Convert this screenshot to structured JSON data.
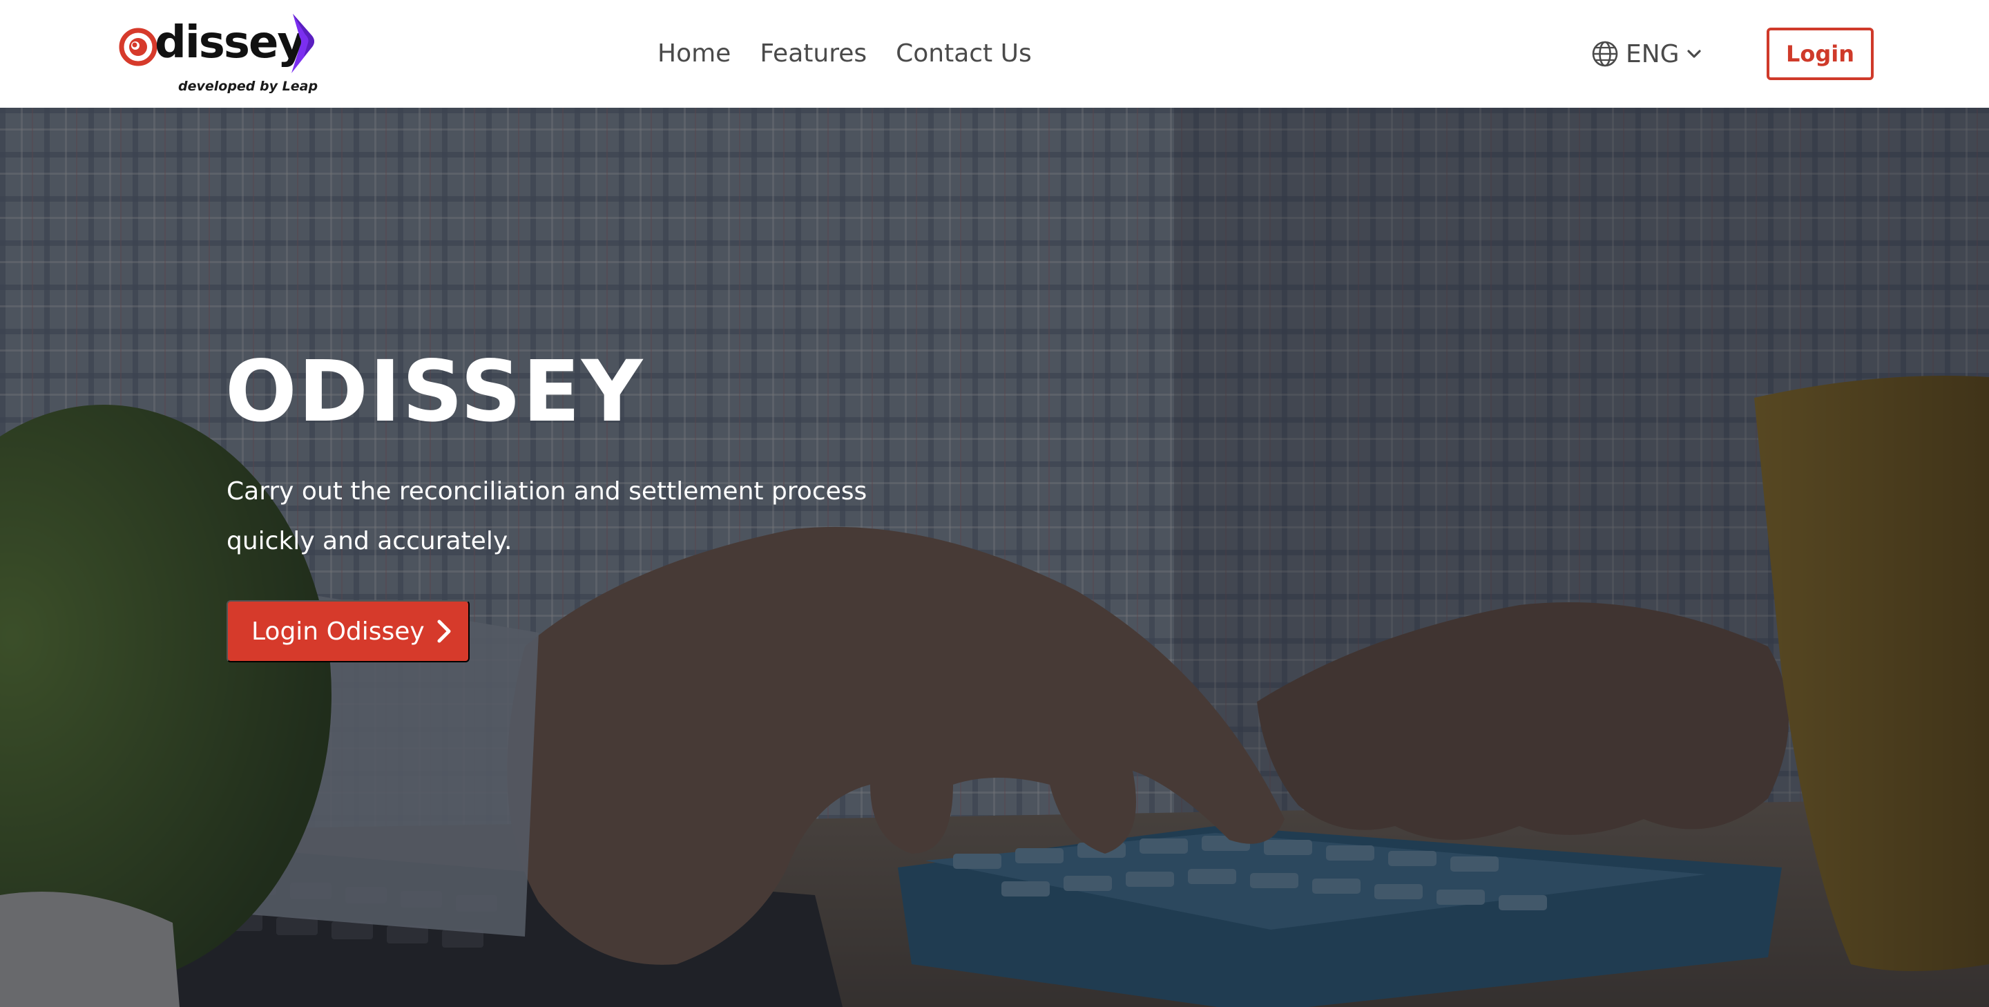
{
  "brand": {
    "logo_text": "dissey",
    "logo_tagline": "developed by Leap",
    "logo_mark_icon": "odissey-o-mark-icon",
    "swoosh_icon": "odissey-swoosh-icon",
    "accent_color": "#d63a2b",
    "swoosh_color": "#7b2ff0"
  },
  "nav": {
    "items": [
      {
        "label": "Home"
      },
      {
        "label": "Features"
      },
      {
        "label": "Contact Us"
      }
    ],
    "language": {
      "icon": "globe-icon",
      "label": "ENG",
      "chevron_icon": "chevron-down-icon"
    },
    "login_label": "Login"
  },
  "hero": {
    "title": "ODISSEY",
    "subtitle": "Carry out the reconciliation and settlement process quickly and accurately.",
    "cta_label": "Login Odissey",
    "cta_icon": "chevron-right-icon",
    "background_image": "hands-using-calculator-photo"
  }
}
